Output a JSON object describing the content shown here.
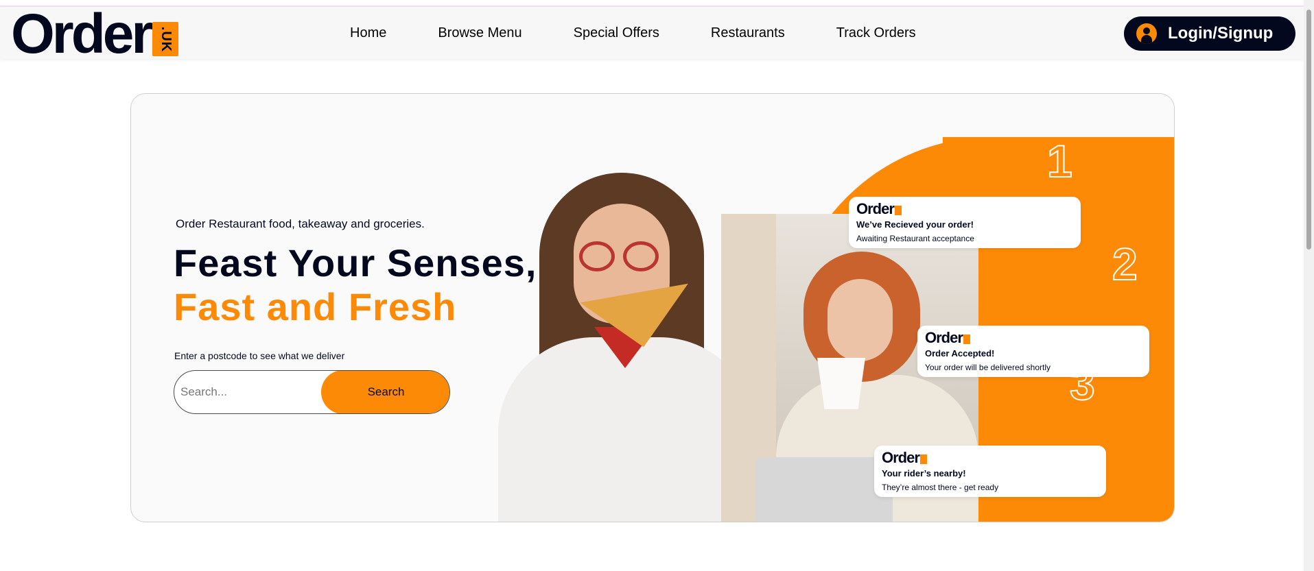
{
  "header": {
    "logo_word": "Order",
    "logo_badge": ".UK",
    "nav": [
      "Home",
      "Browse Menu",
      "Special Offers",
      "Restaurants",
      "Track Orders"
    ],
    "login_label": "Login/Signup"
  },
  "hero": {
    "tagline": "Order Restaurant food, takeaway and groceries.",
    "headline_1": "Feast Your Senses,",
    "headline_2": "Fast and Fresh",
    "postcode_label": "Enter a postcode to see what we deliver",
    "search_placeholder": "Search...",
    "search_button": "Search"
  },
  "steps": [
    {
      "number": "1",
      "title": "We’ve Recieved your order!",
      "text": "Awaiting Restaurant acceptance"
    },
    {
      "number": "2",
      "title": "Order Accepted!",
      "text": "Your order will be delivered shortly"
    },
    {
      "number": "3",
      "title": "Your rider’s nearby!",
      "text": "They’re almost there - get ready"
    }
  ],
  "colors": {
    "brand_orange": "#fc8a06",
    "brand_dark": "#03081f"
  }
}
